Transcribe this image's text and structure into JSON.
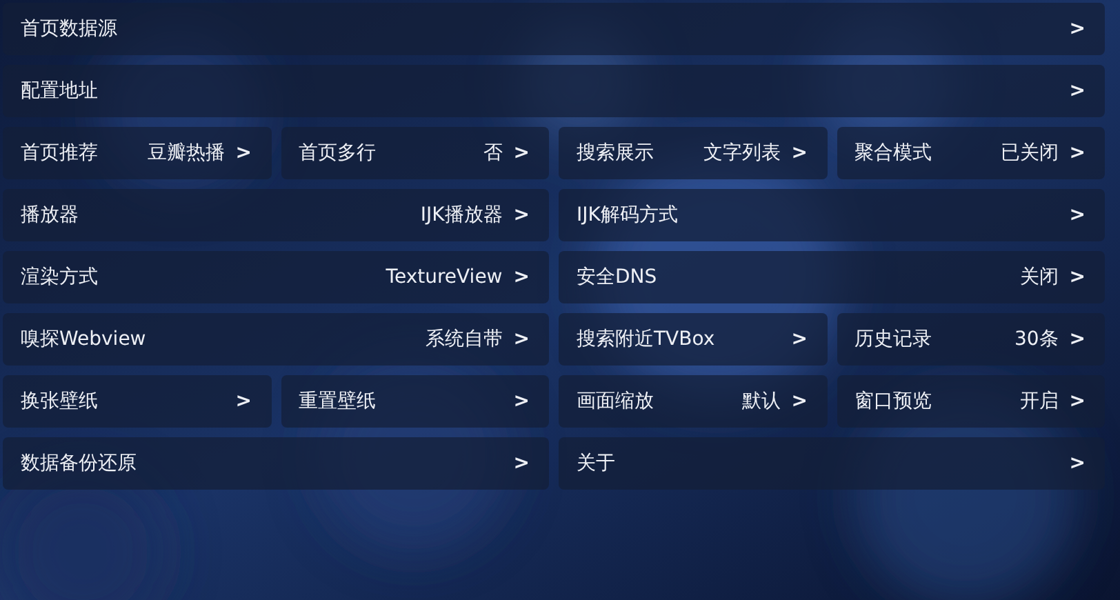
{
  "settings_rows": [
    [
      {
        "label": "首页数据源",
        "arrow": ">"
      }
    ],
    [
      {
        "label": "配置地址",
        "arrow": ">"
      }
    ],
    [
      {
        "label": "首页推荐",
        "value": "豆瓣热播",
        "arrow": ">"
      },
      {
        "label": "首页多行",
        "value": "否",
        "arrow": ">"
      },
      {
        "label": "搜索展示",
        "value": "文字列表",
        "arrow": ">"
      },
      {
        "label": "聚合模式",
        "value": "已关闭",
        "arrow": ">"
      }
    ],
    [
      {
        "label": "播放器",
        "value": "IJK播放器",
        "arrow": ">"
      },
      {
        "label": "IJK解码方式",
        "arrow": ">"
      }
    ],
    [
      {
        "label": "渲染方式",
        "value": "TextureView",
        "arrow": ">"
      },
      {
        "label": "安全DNS",
        "value": "关闭",
        "arrow": ">"
      }
    ],
    [
      {
        "label": "嗅探Webview",
        "value": "系统自带",
        "arrow": ">"
      },
      {
        "label": "搜索附近TVBox",
        "arrow": ">"
      },
      {
        "label": "历史记录",
        "value": "30条",
        "arrow": ">"
      }
    ],
    [
      {
        "label": "换张壁纸",
        "arrow": ">"
      },
      {
        "label": "重置壁纸",
        "arrow": ">"
      },
      {
        "label": "画面缩放",
        "value": "默认",
        "arrow": ">"
      },
      {
        "label": "窗口预览",
        "value": "开启",
        "arrow": ">"
      }
    ],
    [
      {
        "label": "数据备份还原",
        "arrow": ">"
      },
      {
        "label": "关于",
        "arrow": ">"
      }
    ]
  ]
}
